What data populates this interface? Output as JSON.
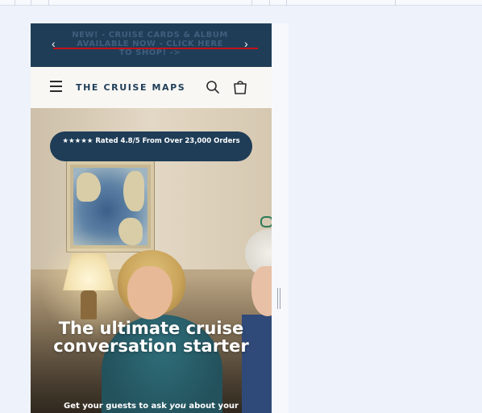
{
  "announcement": {
    "message": "NEW! - CRUISE CARDS & ALBUM AVAILABLE NOW - CLICK HERE TO SHOP! ->",
    "prev_icon": "‹",
    "next_icon": "›"
  },
  "header": {
    "brand": "THE CRUISE MAPS",
    "menu_icon": "hamburger-icon",
    "search_icon": "search-icon",
    "cart_icon": "cart-icon"
  },
  "hero": {
    "rating": "★★★★★ Rated 4.8/5 From Over 23,000 Orders",
    "title": "The ultimate cruise conversation starter",
    "subtitle_start": "Get your guests to ask ",
    "subtitle_emphasis": "you",
    "subtitle_end": " about your"
  },
  "colors": {
    "brand_navy": "#1f3d57",
    "announcement_strike": "#c4121b",
    "page_background": "#eef2fa"
  }
}
